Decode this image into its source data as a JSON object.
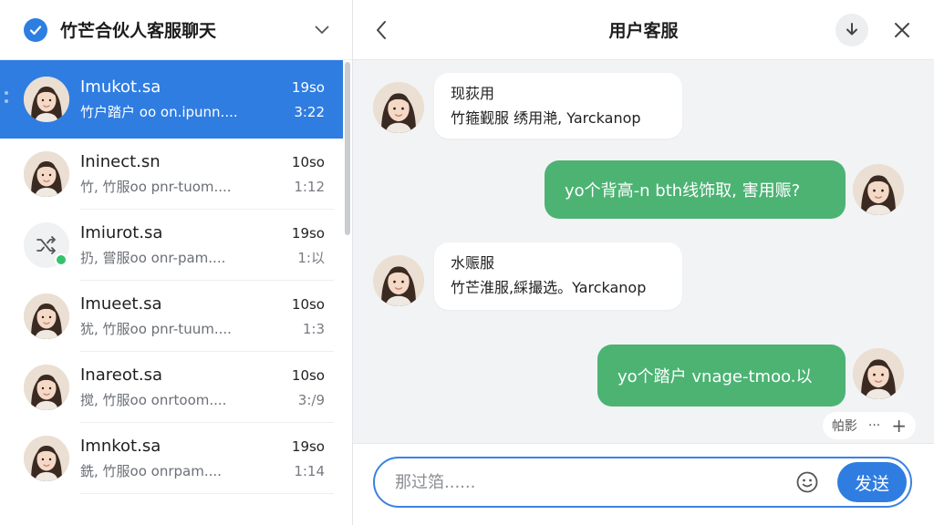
{
  "left_panel": {
    "title": "竹芒合伙人客服聊天"
  },
  "conversations": [
    {
      "name": "Imukot.sa",
      "preview": "竹户踏户 oo on.ipunn....",
      "time": "19so",
      "sub": "3:22",
      "active": true,
      "avatar": "portrait"
    },
    {
      "name": "Ininect.sn",
      "preview": "竹, 竹服oo pnr-tuom....",
      "time": "10so",
      "sub": "1:12",
      "active": false,
      "avatar": "portrait"
    },
    {
      "name": "Imiurot.sa",
      "preview": "扔, 嘗服oo onr-pam....",
      "time": "19so",
      "sub": "1:以",
      "active": false,
      "avatar": "shuffle"
    },
    {
      "name": "Imueet.sa",
      "preview": "犹, 竹服oo pnr-tuum....",
      "time": "10so",
      "sub": "1:3",
      "active": false,
      "avatar": "portrait"
    },
    {
      "name": "Inareot.sa",
      "preview": "搅, 竹服oo onrtoom....",
      "time": "10so",
      "sub": "3:/9",
      "active": false,
      "avatar": "portrait"
    },
    {
      "name": "Imnkot.sa",
      "preview": "銑, 竹服oo onrpam....",
      "time": "19so",
      "sub": "1:14",
      "active": false,
      "avatar": "portrait"
    }
  ],
  "chat": {
    "title": "用户客服",
    "messages": [
      {
        "dir": "in",
        "line1": "现荻用",
        "line2": "竹箍觐服 绣用滟, Yarckanop"
      },
      {
        "dir": "out",
        "text": "yo个背高‐n bth线饰取, 害用赈?"
      },
      {
        "dir": "in",
        "line1": "水赈服",
        "line2": "竹芒淮服,綵撮选。Yarckanop"
      },
      {
        "dir": "out",
        "text": "yo个踏户 vnage-tmoo.以"
      }
    ],
    "tool_pill": {
      "label": "帕影",
      "more": "···",
      "add": "+"
    },
    "composer": {
      "placeholder": "那过箔......",
      "send_label": "发送"
    }
  },
  "colors": {
    "accent": "#2f7de1",
    "bubble_out": "#4cb373",
    "online": "#35c26a"
  }
}
